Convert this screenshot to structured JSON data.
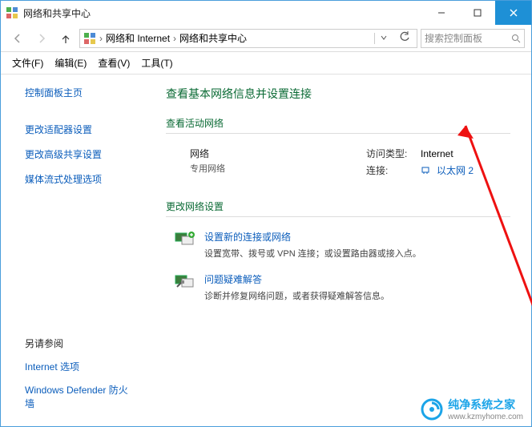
{
  "window": {
    "title": "网络和共享中心"
  },
  "nav": {
    "crumb1": "网络和 Internet",
    "crumb2": "网络和共享中心",
    "searchPlaceholder": "搜索控制面板"
  },
  "menu": {
    "file": "文件(F)",
    "edit": "编辑(E)",
    "view": "查看(V)",
    "tools": "工具(T)"
  },
  "sidebar": {
    "home": "控制面板主页",
    "link1": "更改适配器设置",
    "link2": "更改高级共享设置",
    "link3": "媒体流式处理选项",
    "seeAlso": "另请参阅",
    "inetOptions": "Internet 选项",
    "defender": "Windows Defender 防火墙"
  },
  "main": {
    "title": "查看基本网络信息并设置连接",
    "activeNet": "查看活动网络",
    "netName": "网络",
    "netType": "专用网络",
    "accessTypeLabel": "访问类型:",
    "accessTypeValue": "Internet",
    "connLabel": "连接:",
    "connValue": "以太网 2",
    "changeNet": "更改网络设置",
    "task1Title": "设置新的连接或网络",
    "task1Desc": "设置宽带、拨号或 VPN 连接；或设置路由器或接入点。",
    "task2Title": "问题疑难解答",
    "task2Desc": "诊断并修复网络问题，或者获得疑难解答信息。"
  },
  "watermark": {
    "name": "纯净系统之家",
    "url": "www.kzmyhome.com"
  }
}
